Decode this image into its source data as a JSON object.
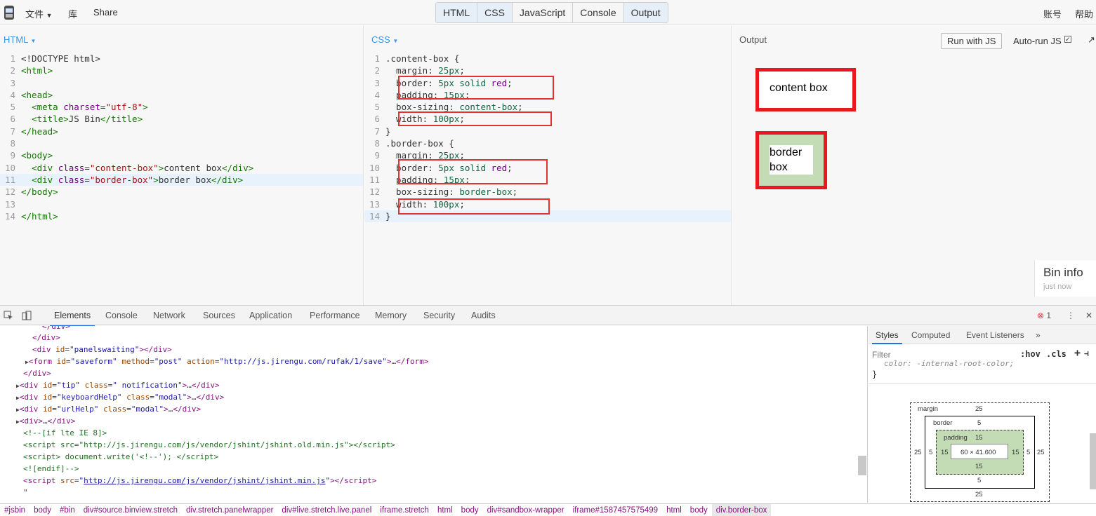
{
  "menu": {
    "file": "文件",
    "lib": "库",
    "share": "Share",
    "account": "账号",
    "help": "帮助"
  },
  "tabs": [
    "HTML",
    "CSS",
    "JavaScript",
    "Console",
    "Output"
  ],
  "html_panel": {
    "title": "HTML",
    "lines": [
      "1",
      "2",
      "3",
      "4",
      "5",
      "6",
      "7",
      "8",
      "9",
      "10",
      "11",
      "12",
      "13",
      "14"
    ]
  },
  "css_panel": {
    "title": "CSS"
  },
  "output": {
    "title": "Output",
    "run_label": "Run with JS",
    "autorun_label": "Auto-run JS",
    "content_box_text": "content box",
    "border_box_text": "border box"
  },
  "bin_info": {
    "title": "Bin info",
    "subtitle": "just now"
  },
  "devtools": {
    "tabs": [
      "Elements",
      "Console",
      "Network",
      "Sources",
      "Application",
      "Performance",
      "Memory",
      "Security",
      "Audits"
    ],
    "error_count": "1"
  },
  "styles": {
    "tabs": [
      "Styles",
      "Computed",
      "Event Listeners"
    ],
    "filter_placeholder": "Filter",
    "hov": ":hov",
    "cls": ".cls",
    "cut_rule": "color: -internal-root-color;",
    "box_model": {
      "margin_label": "margin",
      "margin": "25",
      "border_label": "border",
      "border": "5",
      "padding_label": "padding",
      "padding": "15",
      "content": "60 × 41.600"
    }
  },
  "breadcrumbs": [
    "#jsbin",
    "body",
    "#bin",
    "div#source.binview.stretch",
    "div.stretch.panelwrapper",
    "div#live.stretch.live.panel",
    "iframe.stretch",
    "html",
    "body",
    "div#sandbox-wrapper",
    "iframe#1587457575499",
    "html",
    "body",
    "div.border-box"
  ]
}
